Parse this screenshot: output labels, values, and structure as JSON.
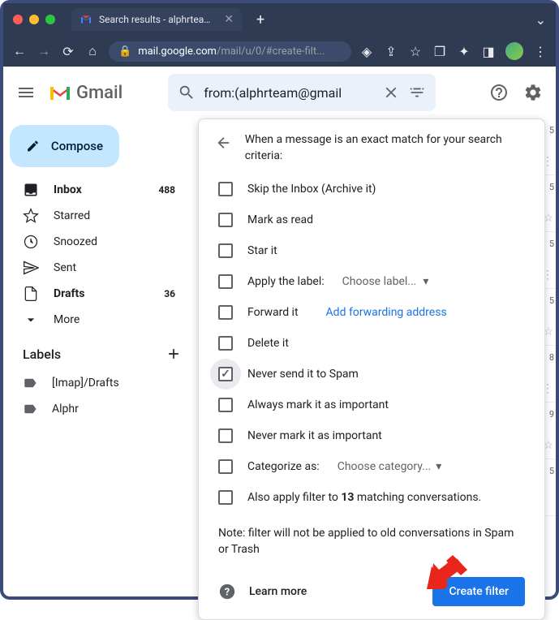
{
  "browser": {
    "tab_title": "Search results - alphrteam@g",
    "url_domain": "mail.google.com",
    "url_path": "/mail/u/0/#create-filt..."
  },
  "header": {
    "app_name": "Gmail",
    "search_value": "from:(alphrteam@gmail"
  },
  "sidebar": {
    "compose": "Compose",
    "items": [
      {
        "label": "Inbox",
        "count": "488",
        "bold": true
      },
      {
        "label": "Starred"
      },
      {
        "label": "Snoozed"
      },
      {
        "label": "Sent"
      },
      {
        "label": "Drafts",
        "count": "36",
        "bold": true
      },
      {
        "label": "More"
      }
    ],
    "labels_header": "Labels",
    "labels": [
      {
        "label": "[Imap]/Drafts"
      },
      {
        "label": "Alphr"
      }
    ]
  },
  "panel": {
    "title": "When a message is an exact match for your search criteria:",
    "options": {
      "skip_inbox": "Skip the Inbox (Archive it)",
      "mark_read": "Mark as read",
      "star_it": "Star it",
      "apply_label": "Apply the label:",
      "choose_label": "Choose label...",
      "forward_it": "Forward it",
      "add_forward": "Add forwarding address",
      "delete_it": "Delete it",
      "never_spam": "Never send it to Spam",
      "mark_important": "Always mark it as important",
      "never_important": "Never mark it as important",
      "categorize": "Categorize as:",
      "choose_category": "Choose category...",
      "also_apply_pre": "Also apply filter to ",
      "also_apply_count": "13",
      "also_apply_post": " matching conversations."
    },
    "note": "Note: filter will not be applied to old conversations in Spam or Trash",
    "learn_more": "Learn more",
    "create_filter": "Create filter"
  },
  "bg_times": [
    "5",
    "5",
    "5",
    "5",
    "8",
    "9",
    "5"
  ]
}
